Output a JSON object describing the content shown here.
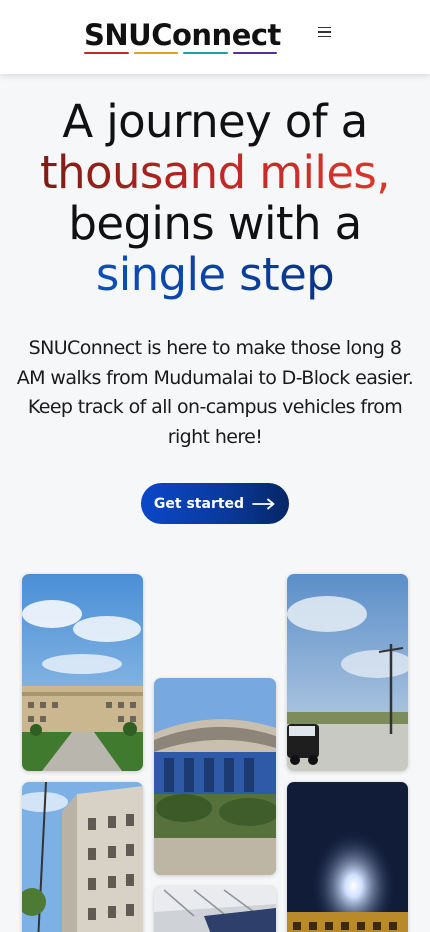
{
  "header": {
    "brand": "SNUConnect",
    "underline_colors": [
      "#c62828",
      "#e0a21a",
      "#1aa3a3",
      "#5a2ca0"
    ],
    "menu_icon": "hamburger-menu-icon"
  },
  "hero": {
    "line1": "A journey of a",
    "line2": "thousand miles,",
    "line3": "begins with a",
    "line4": "single step",
    "description_lines": [
      "SNUConnect is here to make those long 8",
      "AM walks from Mudumalai to D-Block easier.",
      "Keep track of all on-campus vehicles from",
      "right here!"
    ],
    "cta_label": "Get started",
    "cta_icon": "arrow-right-icon"
  },
  "gallery": {
    "photos": [
      {
        "name": "campus-walkway-photo"
      },
      {
        "name": "tall-building-photo"
      },
      {
        "name": "curved-building-photo"
      },
      {
        "name": "interior-ceiling-photo"
      },
      {
        "name": "shuttle-vehicle-photo"
      },
      {
        "name": "night-building-photo"
      }
    ]
  },
  "colors": {
    "accent_red": "#c62828",
    "accent_blue": "#0a3d9a",
    "page_bg": "#f6f7f9"
  }
}
